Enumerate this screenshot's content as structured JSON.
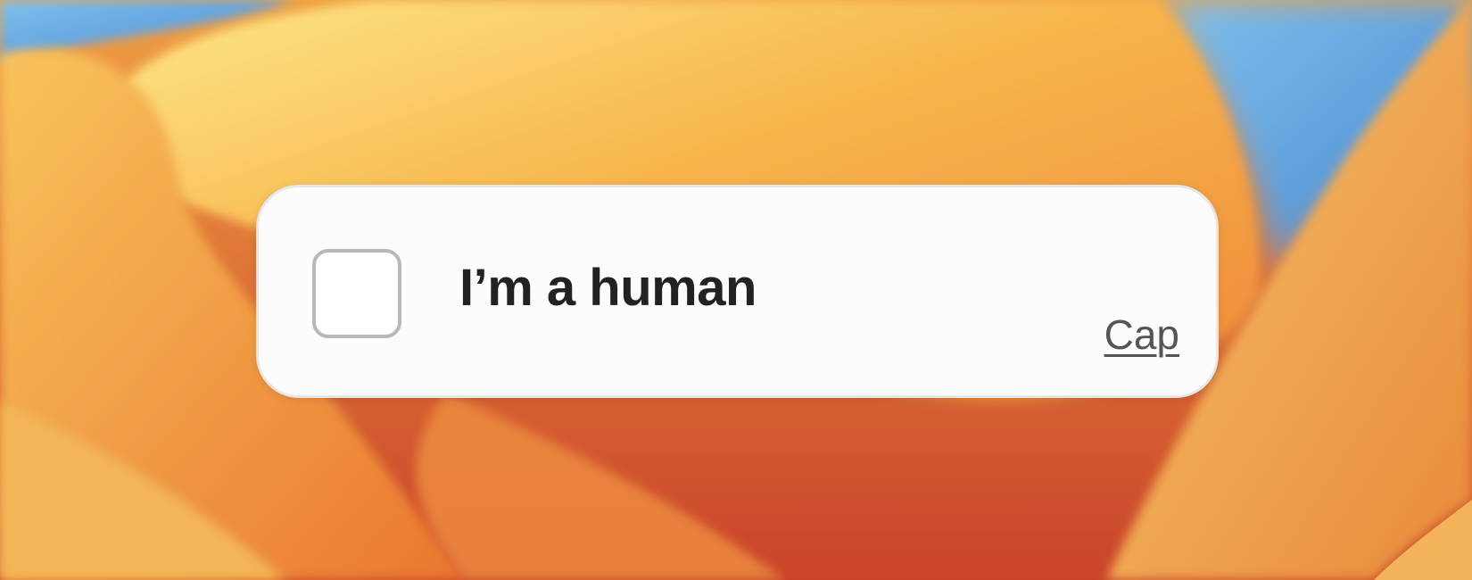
{
  "widget": {
    "checkbox_checked": false,
    "label": "I’m a human",
    "brand_link": "Cap"
  },
  "colors": {
    "card_background": "#fcfcfc",
    "checkbox_border": "#b8b8b8",
    "label_text": "#222222",
    "link_text": "#555555",
    "wallpaper_orange": "#f2a145",
    "wallpaper_sky": "#6aa8e0"
  }
}
